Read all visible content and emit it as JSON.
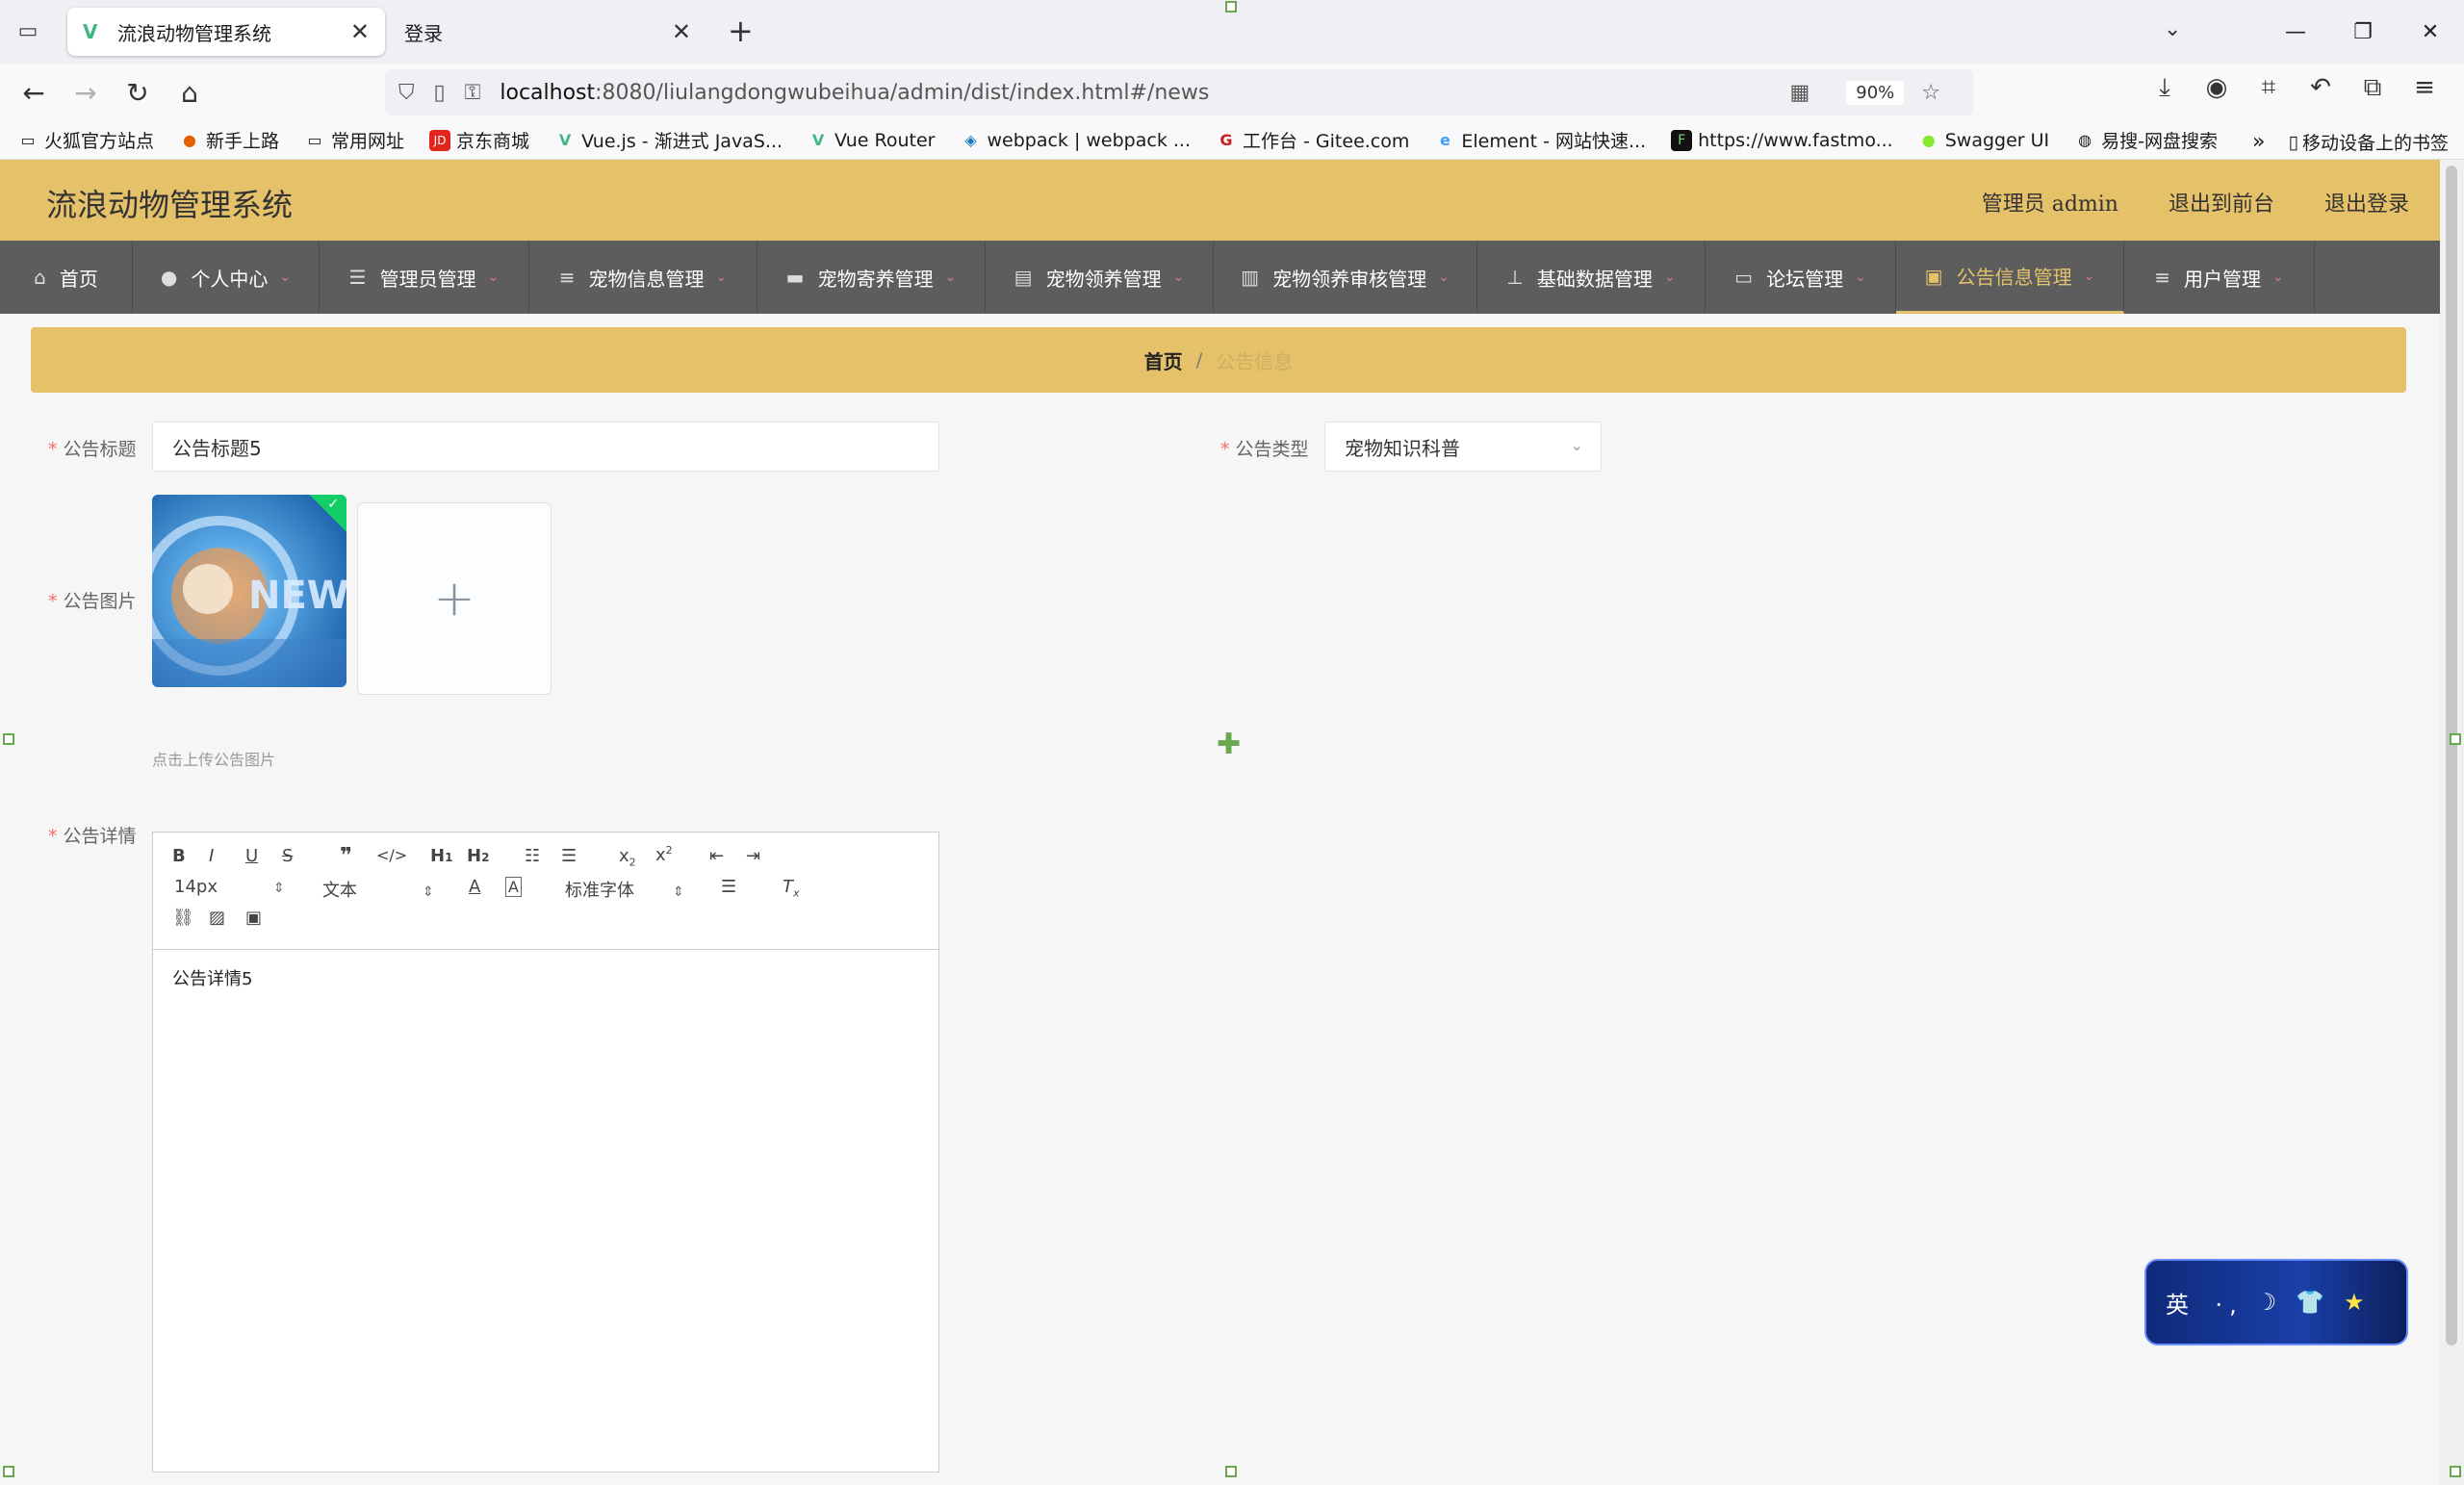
{
  "browser": {
    "tabs": [
      {
        "label": "流浪动物管理系统",
        "favicon": "vue-icon"
      },
      {
        "label": "登录"
      }
    ],
    "url_host": "localhost",
    "url_rest": ":8080/liulangdongwubeihua/admin/dist/index.html#/news",
    "zoom": "90%",
    "bookmarks": [
      "火狐官方站点",
      "新手上路",
      "常用网址",
      "京东商城",
      "Vue.js - 渐进式 JavaS...",
      "Vue Router",
      "webpack | webpack ...",
      "工作台 - Gitee.com",
      "Element - 网站快速...",
      "https://www.fastmo...",
      "Swagger UI",
      "易搜-网盘搜索"
    ],
    "mobile_bookmarks": "移动设备上的书签"
  },
  "app": {
    "title": "流浪动物管理系统",
    "user": "管理员 admin",
    "to_front": "退出到前台",
    "logout": "退出登录",
    "menu": [
      {
        "label": "首页",
        "icon": "home-icon",
        "caret": false
      },
      {
        "label": "个人中心",
        "icon": "user-icon",
        "caret": true
      },
      {
        "label": "管理员管理",
        "icon": "sliders-icon",
        "caret": true
      },
      {
        "label": "宠物信息管理",
        "icon": "list-icon",
        "caret": true
      },
      {
        "label": "宠物寄养管理",
        "icon": "ticket-icon",
        "caret": true
      },
      {
        "label": "宠物领养管理",
        "icon": "clipboard-icon",
        "caret": true
      },
      {
        "label": "宠物领养审核管理",
        "icon": "chart-icon",
        "caret": true
      },
      {
        "label": "基础数据管理",
        "icon": "stamp-icon",
        "caret": true
      },
      {
        "label": "论坛管理",
        "icon": "laptop-icon",
        "caret": true
      },
      {
        "label": "公告信息管理",
        "icon": "briefcase-icon",
        "caret": true
      },
      {
        "label": "用户管理",
        "icon": "list-icon",
        "caret": true
      }
    ],
    "active_menu": "公告信息管理",
    "breadcrumb": {
      "home": "首页",
      "sep": "/",
      "current": "公告信息"
    },
    "form": {
      "title_label": "公告标题",
      "title_value": "公告标题5",
      "type_label": "公告类型",
      "type_value": "宠物知识科普",
      "image_label": "公告图片",
      "image_hint": "点击上传公告图片",
      "detail_label": "公告详情",
      "detail_value": "公告详情5"
    },
    "editor_toolbar": {
      "size": "14px",
      "header": "文本",
      "font": "标准字体"
    },
    "ime": "英"
  }
}
